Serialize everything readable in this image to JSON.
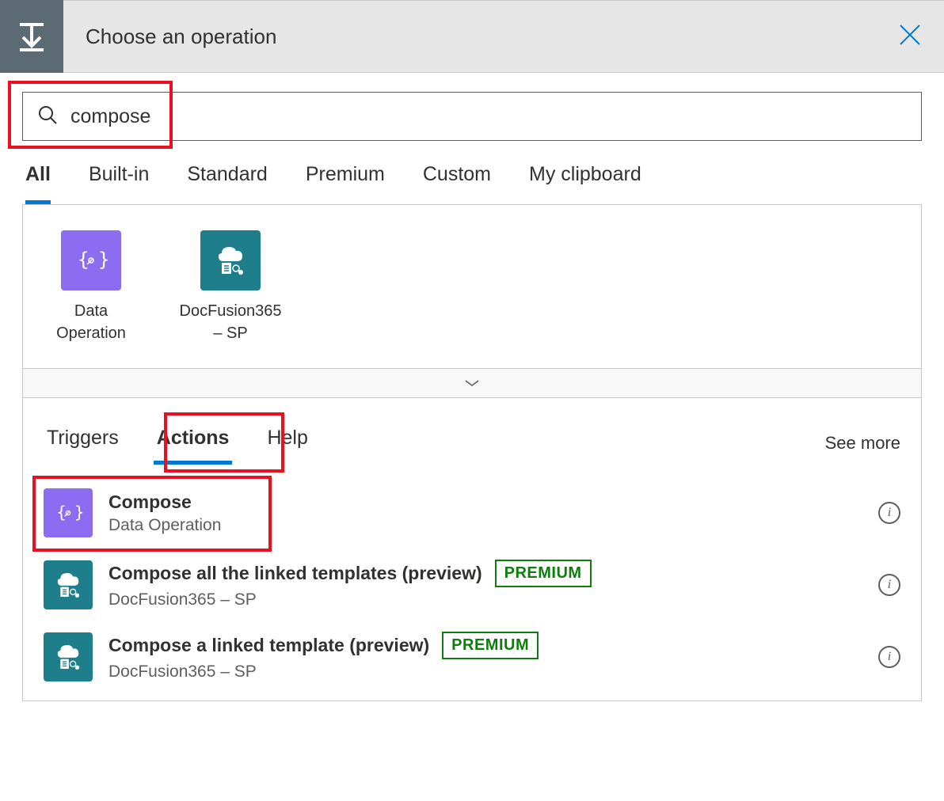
{
  "header": {
    "title": "Choose an operation"
  },
  "search": {
    "value": "compose"
  },
  "category_tabs": [
    {
      "label": "All",
      "active": true
    },
    {
      "label": "Built-in",
      "active": false
    },
    {
      "label": "Standard",
      "active": false
    },
    {
      "label": "Premium",
      "active": false
    },
    {
      "label": "Custom",
      "active": false
    },
    {
      "label": "My clipboard",
      "active": false
    }
  ],
  "connectors": [
    {
      "label": "Data Operation",
      "icon": "data-operation",
      "color": "purple"
    },
    {
      "label": "DocFusion365 – SP",
      "icon": "docfusion",
      "color": "teal"
    }
  ],
  "subtabs": {
    "triggers": "Triggers",
    "actions": "Actions",
    "help": "Help",
    "see_more": "See more"
  },
  "actions": [
    {
      "title": "Compose",
      "subtitle": "Data Operation",
      "icon": "data-operation",
      "color": "purple",
      "premium": false
    },
    {
      "title": "Compose all the linked templates (preview)",
      "subtitle": "DocFusion365 – SP",
      "icon": "docfusion",
      "color": "teal",
      "premium": true
    },
    {
      "title": "Compose a linked template (preview)",
      "subtitle": "DocFusion365 – SP",
      "icon": "docfusion",
      "color": "teal",
      "premium": true
    }
  ],
  "badges": {
    "premium": "PREMIUM"
  }
}
